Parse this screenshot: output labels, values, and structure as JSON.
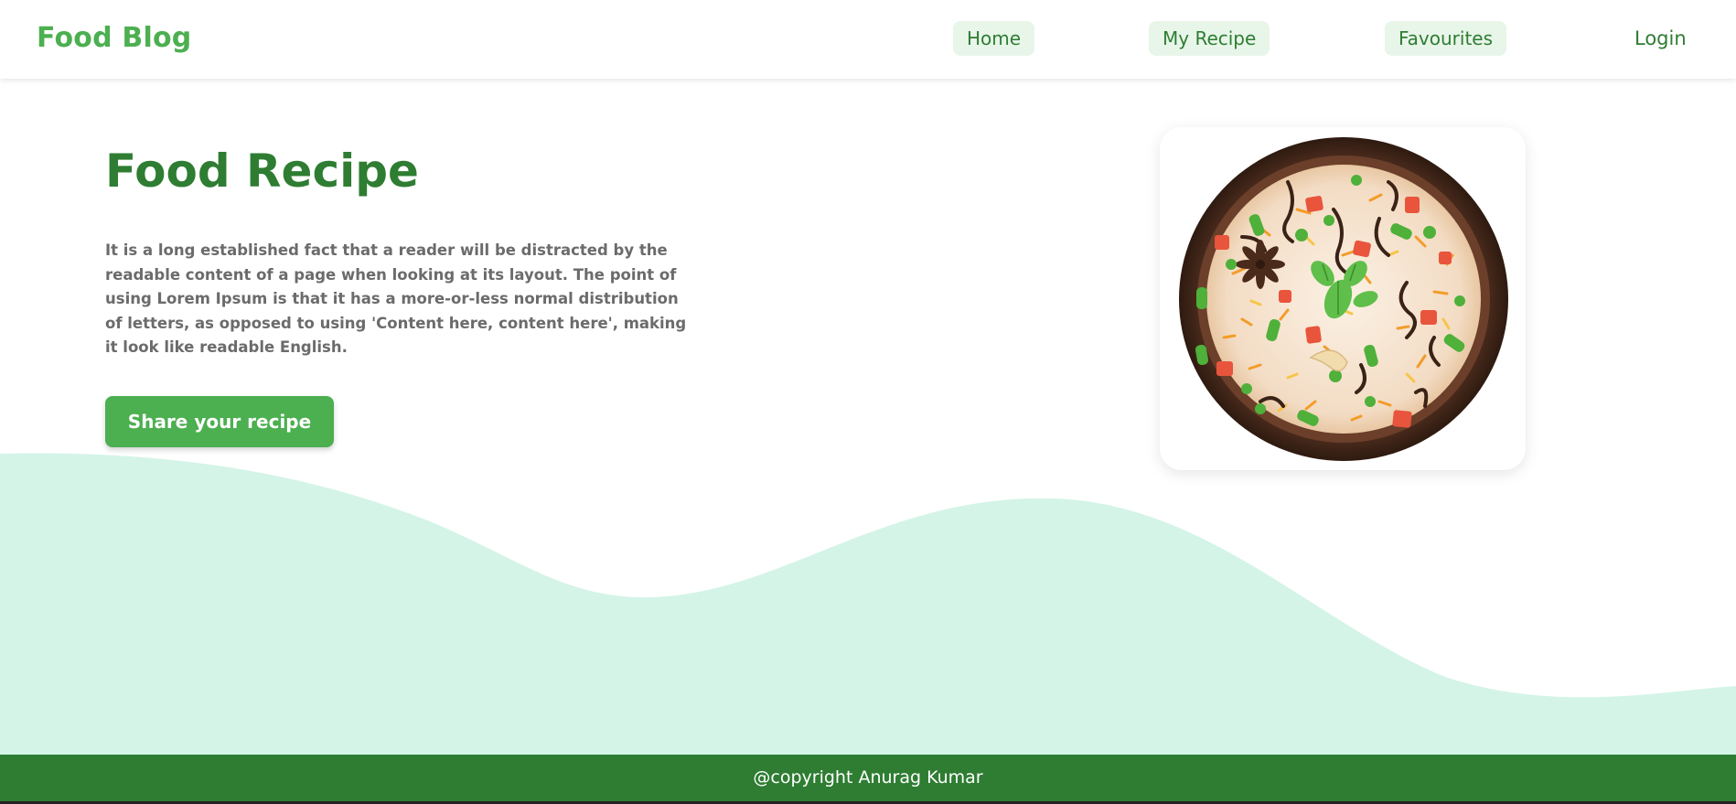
{
  "navbar": {
    "brand": "Food Blog",
    "links": [
      "Home",
      "My Recipe",
      "Favourites"
    ],
    "login": "Login"
  },
  "hero": {
    "title": "Food Recipe",
    "description": "It is a long established fact that a reader will be distracted by the readable content of a page when looking at its layout. The point of using Lorem Ipsum is that it has a more-or-less normal distribution of letters, as opposed to using 'Content here, content here', making it look like readable English.",
    "button_label": "Share your recipe"
  },
  "image": {
    "subject": "biryani-bowl-image"
  },
  "footer": {
    "text": "@copyright Anurag Kumar"
  },
  "colors": {
    "brand": "#4caf50",
    "primary_dark": "#2e7d32",
    "nav_pill": "#e8f5e9",
    "wave": "#d4f4e7",
    "footer": "#2e7d32"
  }
}
